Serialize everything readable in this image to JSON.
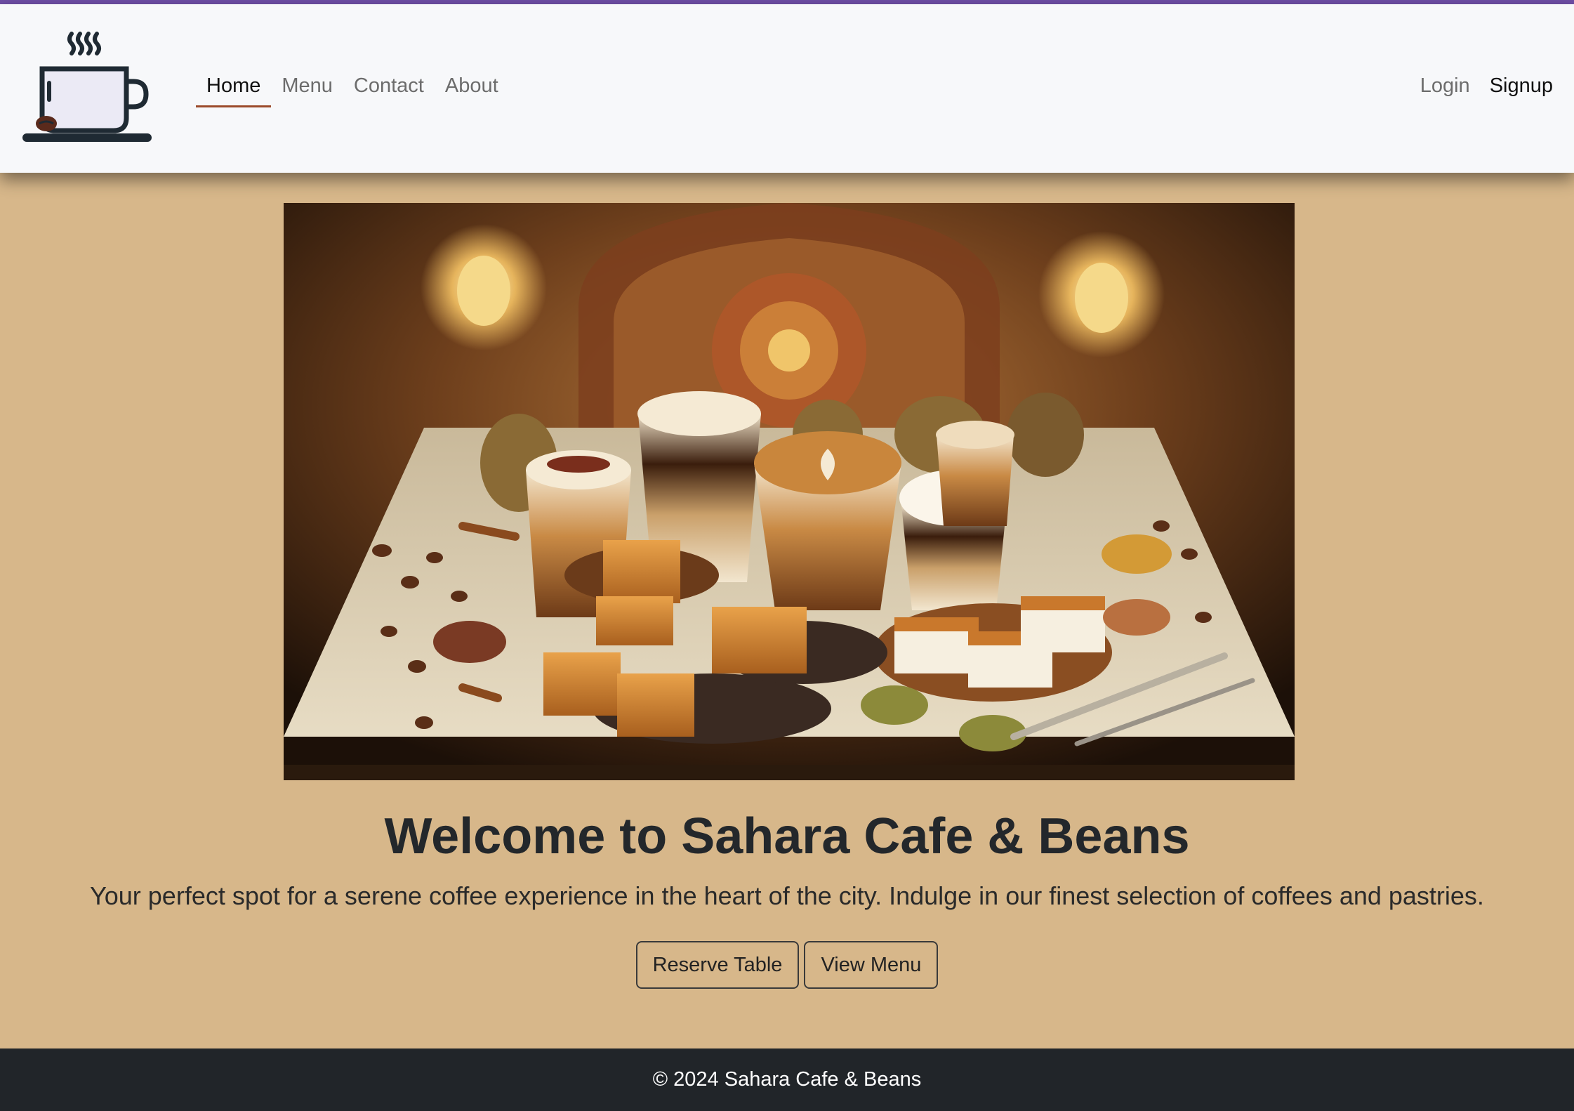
{
  "navbar": {
    "logo_icon": "coffee-cup-icon",
    "links": [
      {
        "label": "Home",
        "active": true
      },
      {
        "label": "Menu",
        "active": false
      },
      {
        "label": "Contact",
        "active": false
      },
      {
        "label": "About",
        "active": false
      }
    ],
    "login_label": "Login",
    "signup_label": "Signup"
  },
  "hero": {
    "image_description": "Arabic coffee drinks and pastries on a table",
    "title": "Welcome to Sahara Cafe & Beans",
    "subtitle": "Your perfect spot for a serene coffee experience in the heart of the city. Indulge in our finest selection of coffees and pastries.",
    "reserve_label": "Reserve Table",
    "view_menu_label": "View Menu"
  },
  "footer": {
    "text": "© 2024 Sahara Cafe & Beans"
  },
  "colors": {
    "accent_bar": "#6f4fa6",
    "page_background": "#d7b78a",
    "navbar_background": "#f7f8fa",
    "active_underline": "#9b4a2a",
    "footer_background": "#212529"
  }
}
